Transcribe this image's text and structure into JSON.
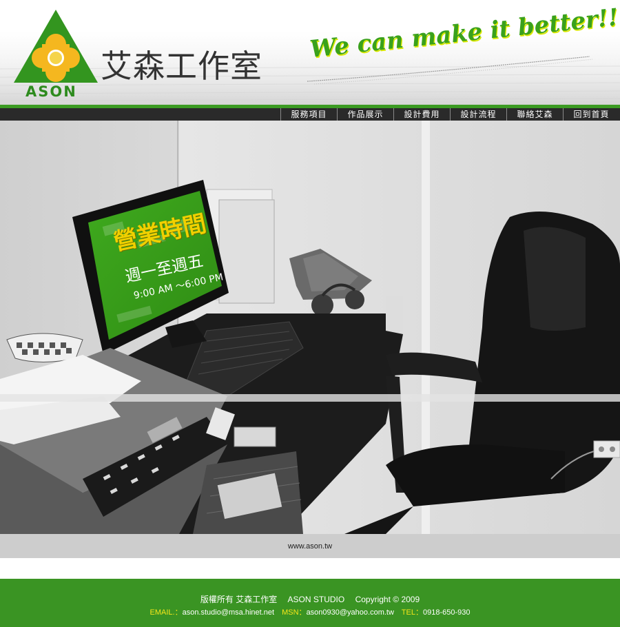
{
  "header": {
    "brand_en": "ASON",
    "brand_zh": "艾森工作室",
    "slogan": "We can make it better!!"
  },
  "nav": {
    "items": [
      {
        "label": "服務項目"
      },
      {
        "label": "作品展示"
      },
      {
        "label": "設計費用"
      },
      {
        "label": "設計流程"
      },
      {
        "label": "聯絡艾森"
      },
      {
        "label": "回到首頁"
      }
    ]
  },
  "hero": {
    "hours_title": "營業時間",
    "hours_days": "週一至週五",
    "hours_time": "9:00 AM ～6:00 PM"
  },
  "url_strip": {
    "text": "www.ason.tw"
  },
  "footer": {
    "copyright_zh": "版權所有 艾森工作室",
    "studio_en": "ASON STUDIO",
    "copyright": "Copyright © 2009",
    "email_label": "EMAIL.：",
    "email": "ason.studio@msa.hinet.net",
    "msn_label": "MSN：",
    "msn": "ason0930@yahoo.com.tw",
    "tel_label": "TEL：",
    "tel": "0918-650-930"
  },
  "colors": {
    "brand_green": "#3a9423",
    "nav_dark": "#2a2a2a",
    "highlight_yellow": "#f5e61a",
    "logo_orange": "#f2a81d"
  }
}
